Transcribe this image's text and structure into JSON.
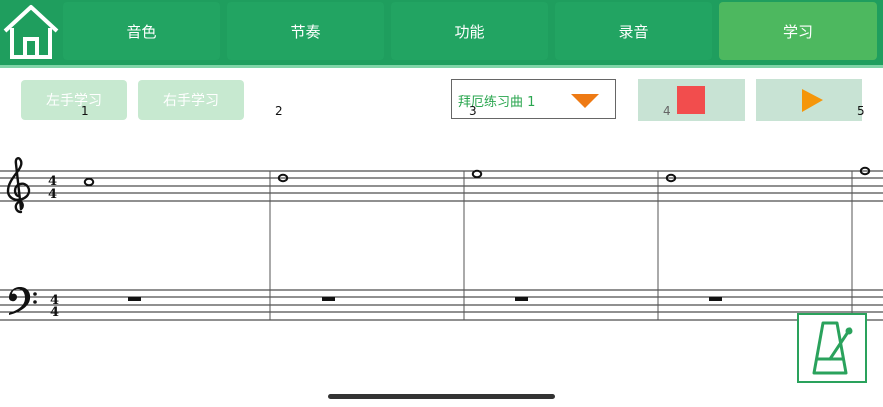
{
  "header": {
    "tabs": [
      {
        "label": "音色"
      },
      {
        "label": "节奏"
      },
      {
        "label": "功能"
      },
      {
        "label": "录音"
      },
      {
        "label": "学习",
        "active": true
      }
    ]
  },
  "controls": {
    "left_hand_label": "左手学习",
    "right_hand_label": "右手学习",
    "song_select": "拜厄练习曲 1",
    "stop_color": "#f24d4d",
    "play_color": "#f5960a"
  },
  "markers": [
    "1",
    "2",
    "3",
    "4",
    "5"
  ],
  "score": {
    "time_signature_top": "4",
    "time_signature_bottom": "4",
    "measures": 5
  },
  "colors": {
    "header": "#1f9e5e",
    "tab": "#22a462",
    "tab_active": "#4db85f",
    "accent_green": "#2aa25c"
  },
  "icons": {
    "home": "home-icon",
    "metronome": "metronome-icon",
    "dropdown": "triangle-down-icon"
  }
}
